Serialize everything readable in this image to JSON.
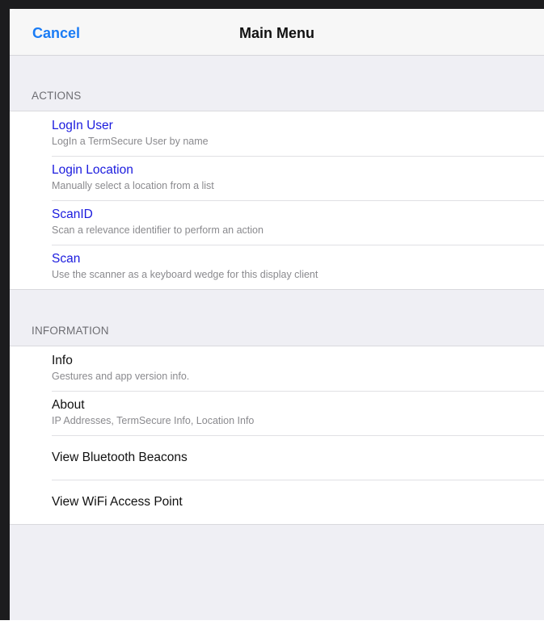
{
  "navbar": {
    "cancel_label": "Cancel",
    "title": "Main Menu"
  },
  "actions": {
    "header": "ACTIONS",
    "items": [
      {
        "title": "LogIn User",
        "subtitle": "LogIn a TermSecure User by name"
      },
      {
        "title": "Login Location",
        "subtitle": "Manually select a location from a list"
      },
      {
        "title": "ScanID",
        "subtitle": "Scan a relevance identifier to perform an action"
      },
      {
        "title": "Scan",
        "subtitle": "Use the scanner as a keyboard wedge for this display client"
      }
    ]
  },
  "information": {
    "header": "INFORMATION",
    "items": [
      {
        "title": "Info",
        "subtitle": "Gestures and app version info."
      },
      {
        "title": "About",
        "subtitle": "IP Addresses, TermSecure Info, Location Info"
      },
      {
        "title": "View Bluetooth Beacons"
      },
      {
        "title": "View WiFi Access Point"
      }
    ]
  },
  "colors": {
    "link": "#1b1bde",
    "accent": "#1a7cf5",
    "background": "#efeff4"
  }
}
